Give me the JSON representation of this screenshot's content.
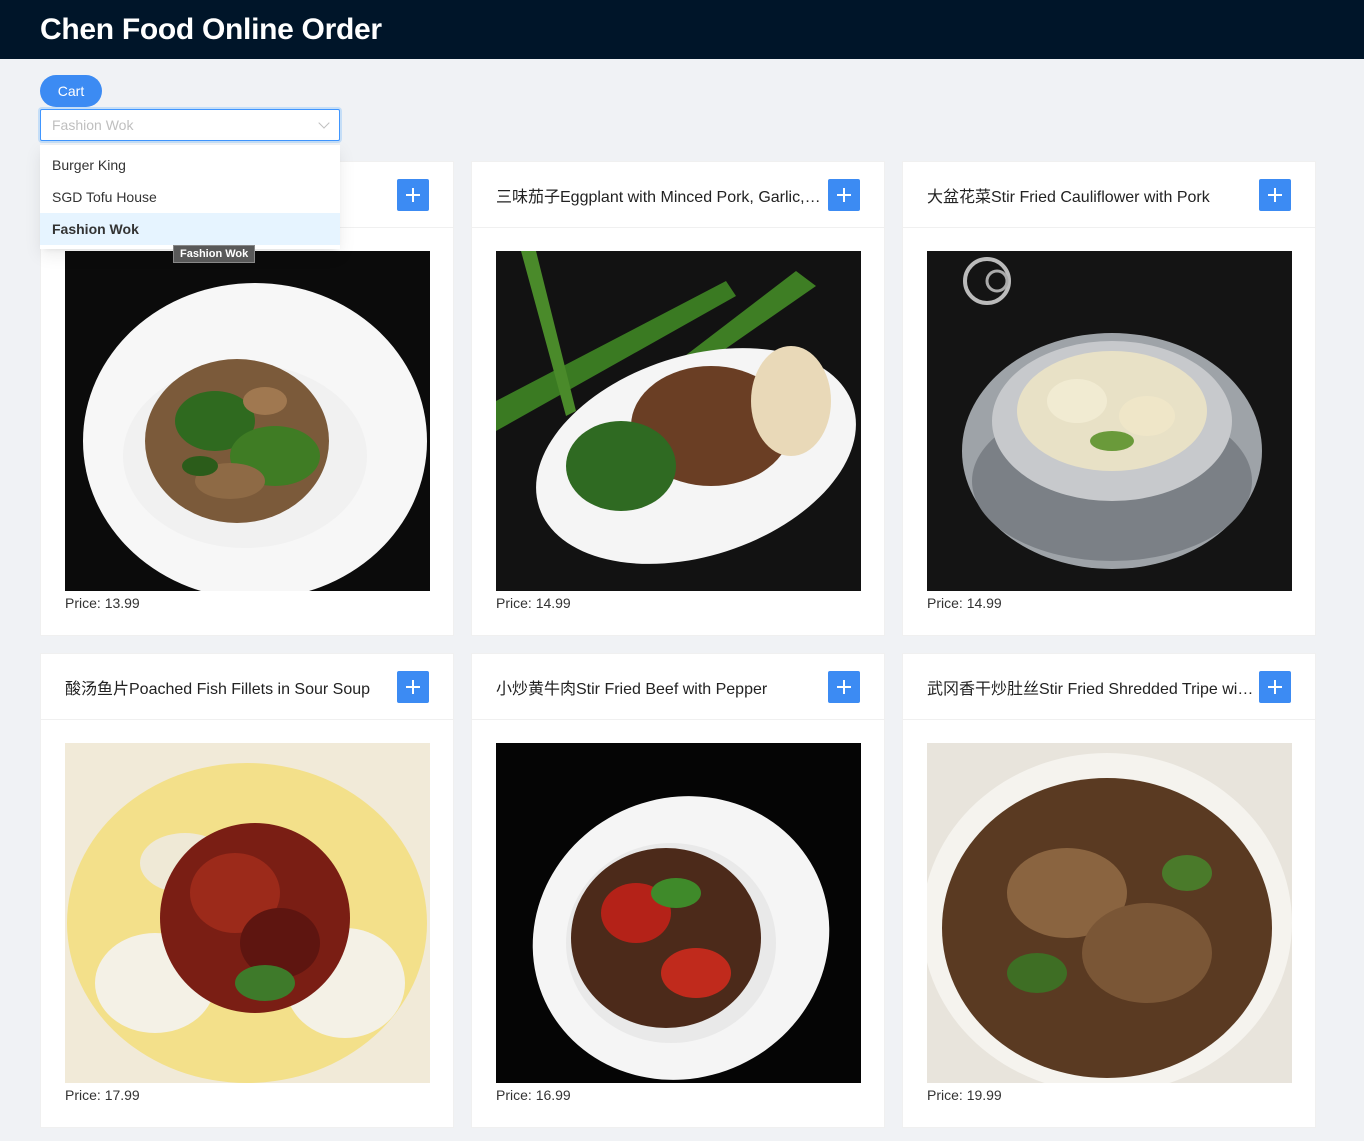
{
  "app": {
    "title": "Chen Food Online Order"
  },
  "cart": {
    "label": "Cart"
  },
  "restaurant_select": {
    "value": "Fashion Wok",
    "options": [
      "Burger King",
      "SGD Tofu House",
      "Fashion Wok"
    ],
    "tooltip": "Fashion Wok"
  },
  "price_prefix": "Price: ",
  "menu": [
    {
      "name": "",
      "price": "13.99",
      "photo": "dark"
    },
    {
      "name": "三味茄子Eggplant with Minced Pork, Garlic, Cilantro",
      "price": "14.99",
      "photo": "dark"
    },
    {
      "name": "大盆花菜Stir Fried Cauliflower with Pork",
      "price": "14.99",
      "photo": "dark"
    },
    {
      "name": "酸汤鱼片Poached Fish Fillets in Sour Soup",
      "price": "17.99",
      "photo": "light"
    },
    {
      "name": "小炒黄牛肉Stir Fried Beef with Pepper",
      "price": "16.99",
      "photo": "dark"
    },
    {
      "name": "武冈香干炒肚丝Stir Fried Shredded Tripe with Dried Tofu",
      "price": "19.99",
      "photo": "light"
    }
  ],
  "colors": {
    "header": "#001529",
    "primary": "#3c8bf3",
    "background": "#f0f2f5"
  }
}
